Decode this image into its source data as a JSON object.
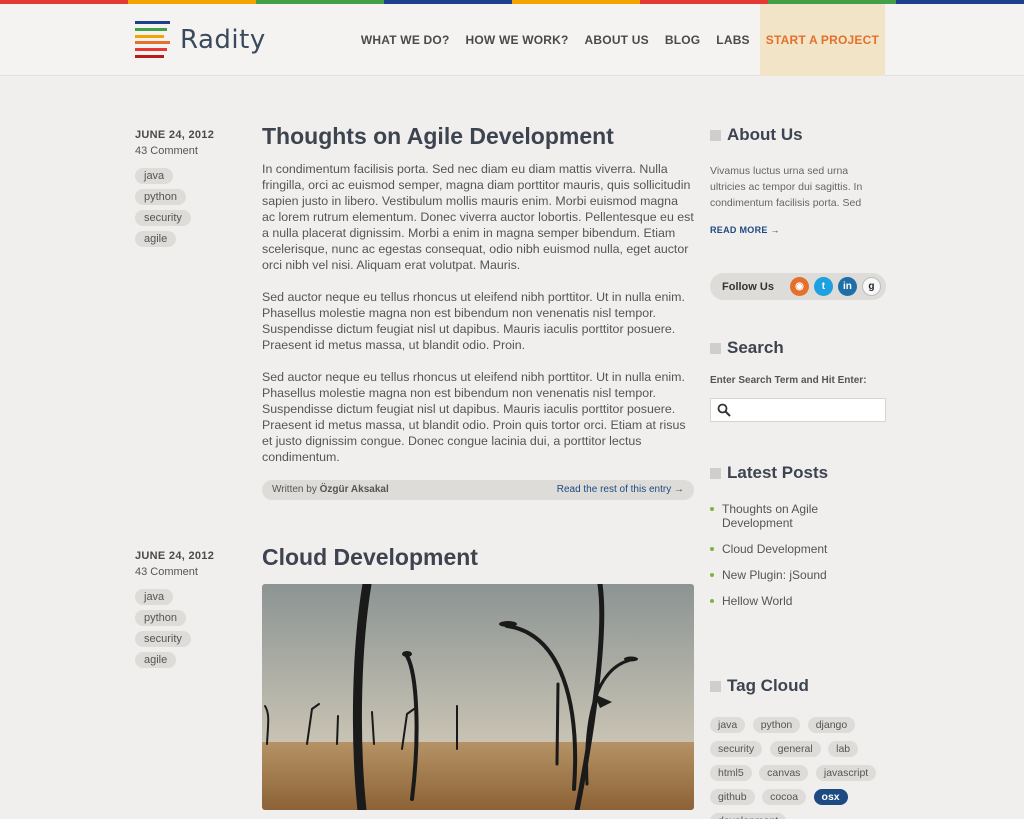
{
  "header": {
    "logo_text": "Radity",
    "nav": [
      {
        "label": "WHAT WE DO?"
      },
      {
        "label": "HOW WE WORK?"
      },
      {
        "label": "ABOUT US"
      },
      {
        "label": "BLOG"
      },
      {
        "label": "LABS"
      },
      {
        "label": "START A PROJECT"
      }
    ]
  },
  "colors": {
    "stripe": [
      "#e53935",
      "#f4a400",
      "#43a047",
      "#1e3f8c",
      "#f4a400",
      "#e53935",
      "#43a047",
      "#1e3f8c"
    ],
    "logo_bars": [
      "#1e3f8c",
      "#43a047",
      "#f4a400",
      "#e5702c",
      "#e53935",
      "#b71c1c"
    ],
    "accent_link": "#1d4a82",
    "cta": "#e5702c"
  },
  "posts": [
    {
      "date": "JUNE 24, 2012",
      "comments": "43 Comment",
      "tags": [
        "java",
        "python",
        "security",
        "agile"
      ],
      "title": "Thoughts on Agile Development",
      "paragraphs": [
        "In condimentum facilisis porta. Sed nec diam eu diam mattis viverra. Nulla fringilla, orci ac euismod semper, magna diam porttitor mauris, quis sollicitudin sapien justo in libero. Vestibulum mollis mauris enim. Morbi euismod magna ac lorem rutrum elementum. Donec viverra auctor lobortis. Pellentesque eu est a nulla placerat dignissim. Morbi a enim in magna semper bibendum. Etiam scelerisque, nunc ac egestas consequat, odio nibh euismod nulla, eget auctor orci nibh vel nisi. Aliquam erat volutpat. Mauris.",
        "Sed auctor neque eu tellus rhoncus ut eleifend nibh porttitor. Ut in nulla enim. Phasellus molestie magna non est bibendum non venenatis nisl tempor. Suspendisse dictum feugiat nisl ut dapibus. Mauris iaculis porttitor posuere. Praesent id metus massa, ut blandit odio. Proin.",
        "Sed auctor neque eu tellus rhoncus ut eleifend nibh porttitor. Ut in nulla enim. Phasellus molestie magna non est bibendum non venenatis nisl tempor. Suspendisse dictum feugiat nisl ut dapibus. Mauris iaculis porttitor posuere. Praesent id metus massa, ut blandit odio. Proin quis tortor orci. Etiam at risus et justo dignissim congue. Donec congue lacinia dui, a porttitor lectus condimentum."
      ],
      "written_by": "Written by",
      "author": "Özgür Aksakal",
      "read_rest": "Read the rest of this entry →"
    },
    {
      "date": "JUNE 24, 2012",
      "comments": "43 Comment",
      "tags": [
        "java",
        "python",
        "security",
        "agile"
      ],
      "title": "Cloud Development",
      "image_icon": "streetlamps-photo"
    }
  ],
  "sidebar": {
    "about": {
      "heading": "About Us",
      "text": "Vivamus luctus urna sed urna ultricies ac tempor dui sagittis. In condimentum facilisis porta. Sed",
      "read_more": "READ MORE →"
    },
    "follow": {
      "label": "Follow Us",
      "icons": [
        "rss-icon",
        "twitter-icon",
        "linkedin-icon",
        "github-icon"
      ],
      "glyphs": [
        "◉",
        "t",
        "in",
        "g"
      ]
    },
    "search": {
      "heading": "Search",
      "label": "Enter Search Term and Hit Enter:",
      "placeholder": "",
      "value": ""
    },
    "latest": {
      "heading": "Latest Posts",
      "items": [
        "Thoughts on Agile Development",
        "Cloud Development",
        "New Plugin: jSound",
        "Hellow World"
      ]
    },
    "tag_cloud": {
      "heading": "Tag Cloud",
      "tags": [
        "java",
        "python",
        "django",
        "security",
        "general",
        "lab",
        "html5",
        "canvas",
        "javascript",
        "github",
        "cocoa",
        "osx",
        "development"
      ],
      "active": "osx"
    }
  }
}
